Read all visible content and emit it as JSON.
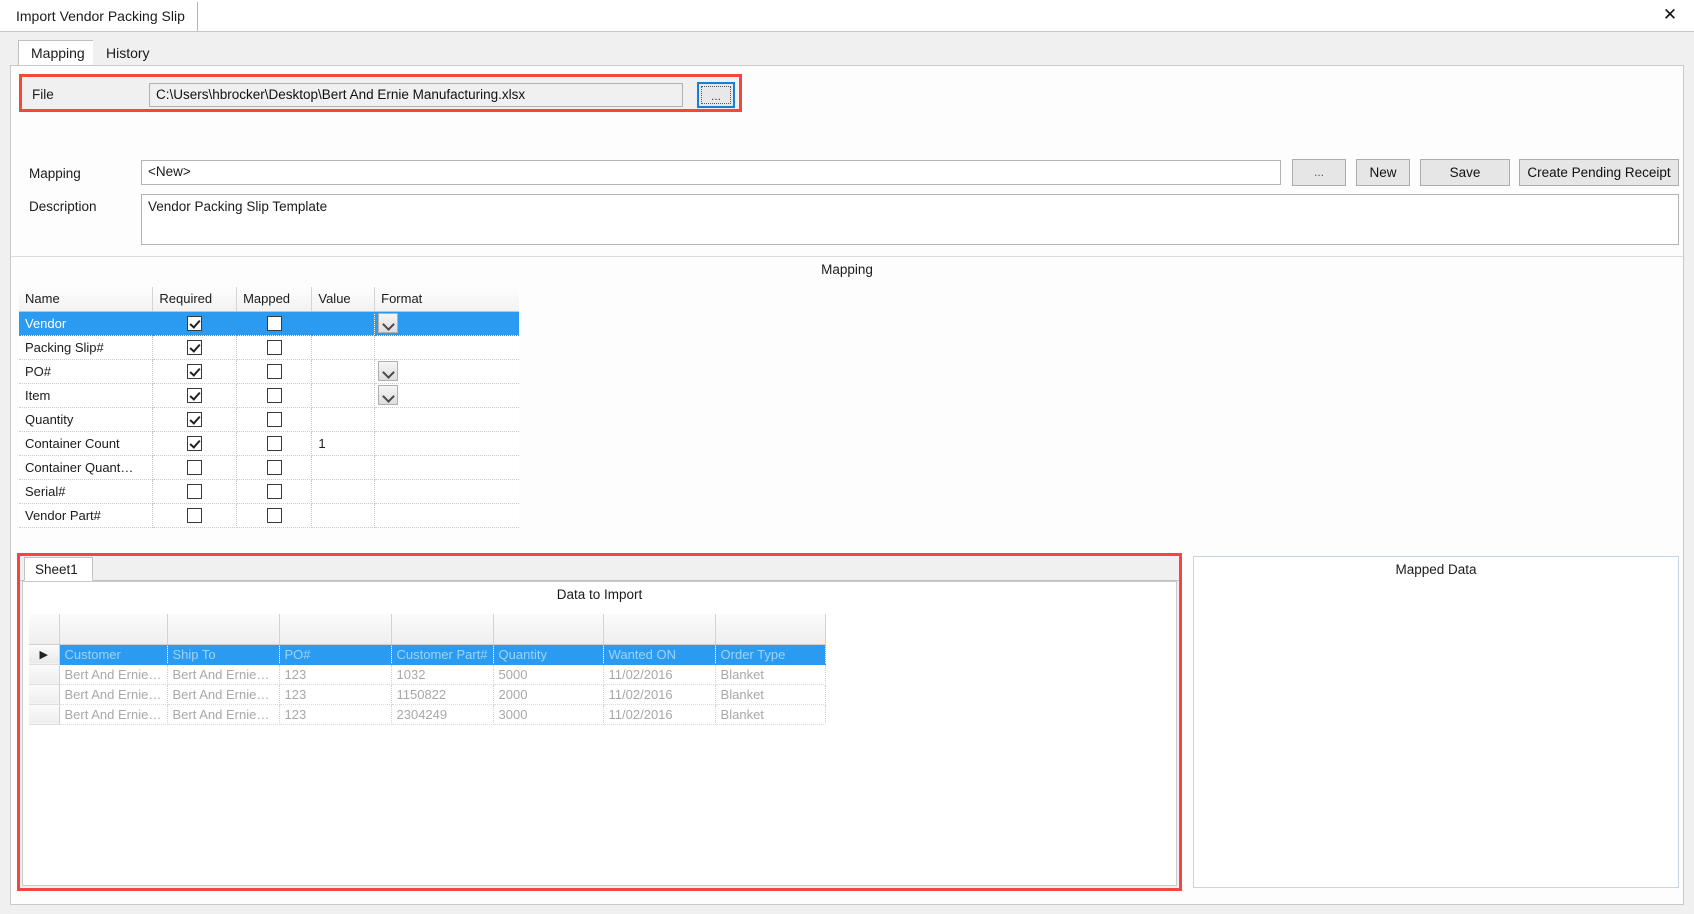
{
  "window": {
    "document_tab": "Import Vendor Packing Slip",
    "close_label": "✕"
  },
  "tabs": [
    {
      "label": "Mapping",
      "active": true
    },
    {
      "label": "History",
      "active": false
    }
  ],
  "file_section": {
    "label": "File",
    "value": "C:\\Users\\hbrocker\\Desktop\\Bert And Ernie Manufacturing.xlsx",
    "browse_label": "...",
    "highlight_color": "#f4463c",
    "focus_color": "#1a7fd4"
  },
  "mapping_section": {
    "label": "Mapping",
    "value": "<New>",
    "buttons": {
      "browse": "...",
      "new": "New",
      "save": "Save",
      "create": "Create Pending Receipt"
    }
  },
  "description_section": {
    "label": "Description",
    "value": "Vendor Packing Slip Template"
  },
  "mapping_grid": {
    "caption": "Mapping",
    "columns": [
      "Name",
      "Required",
      "Mapped",
      "Value",
      "Format"
    ],
    "rows": [
      {
        "name": "Vendor",
        "required": true,
        "mapped": false,
        "value": "",
        "format": "",
        "dropdown": true,
        "selected": true
      },
      {
        "name": "Packing Slip#",
        "required": true,
        "mapped": false,
        "value": "",
        "format": "",
        "dropdown": false,
        "selected": false
      },
      {
        "name": "PO#",
        "required": true,
        "mapped": false,
        "value": "",
        "format": "",
        "dropdown": true,
        "selected": false
      },
      {
        "name": "Item",
        "required": true,
        "mapped": false,
        "value": "",
        "format": "",
        "dropdown": true,
        "selected": false
      },
      {
        "name": "Quantity",
        "required": true,
        "mapped": false,
        "value": "",
        "format": "",
        "dropdown": false,
        "selected": false
      },
      {
        "name": "Container Count",
        "required": true,
        "mapped": false,
        "value": "1",
        "format": "",
        "dropdown": false,
        "selected": false
      },
      {
        "name": "Container  Quant…",
        "required": false,
        "mapped": false,
        "value": "",
        "format": "",
        "dropdown": false,
        "selected": false
      },
      {
        "name": "Serial#",
        "required": false,
        "mapped": false,
        "value": "",
        "format": "",
        "dropdown": false,
        "selected": false
      },
      {
        "name": "Vendor Part#",
        "required": false,
        "mapped": false,
        "value": "",
        "format": "",
        "dropdown": false,
        "selected": false
      }
    ]
  },
  "sheet_panel": {
    "sheet_tab": "Sheet1",
    "caption": "Data to Import",
    "row_marker": "▶",
    "headers": [
      "Customer",
      "Ship To",
      "PO#",
      "Customer Part#",
      "Quantity",
      "Wanted ON",
      "Order Type"
    ],
    "rows": [
      [
        "Bert And Ernie…",
        "Bert And Ernie…",
        "123",
        "1032",
        "5000",
        "11/02/2016",
        "Blanket"
      ],
      [
        "Bert And Ernie…",
        "Bert And Ernie…",
        "123",
        "1150822",
        "2000",
        "11/02/2016",
        "Blanket"
      ],
      [
        "Bert And Ernie…",
        "Bert And Ernie…",
        "123",
        "2304249",
        "3000",
        "11/02/2016",
        "Blanket"
      ]
    ]
  },
  "mapped_panel": {
    "caption": "Mapped Data"
  }
}
